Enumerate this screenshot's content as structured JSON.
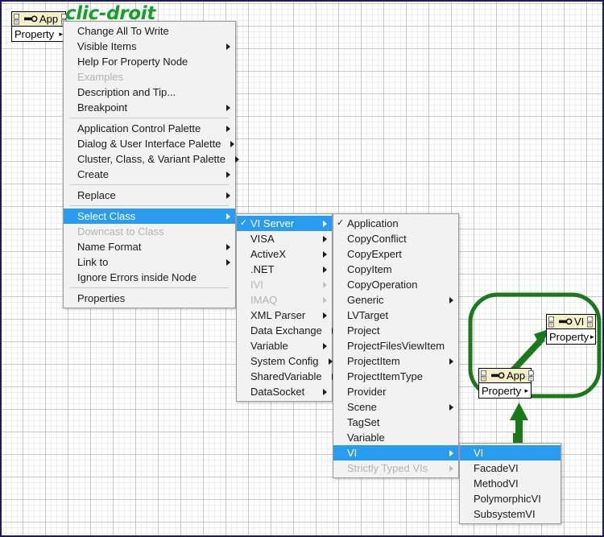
{
  "canvas": {
    "title": "clic-droit",
    "title_color": "#14a02a",
    "accent_highlight": "#2a9cf0",
    "annotation_color": "#1a7a1a",
    "border_color": "#1b1b5e"
  },
  "nodes": {
    "app_node_topleft": {
      "ref_label": "App",
      "body_label": "Property",
      "arrow": "▸"
    },
    "app_node_circle": {
      "ref_label": "App",
      "body_label": "Property",
      "arrow": "▸"
    },
    "vi_node_circle": {
      "ref_label": "VI",
      "body_label": "Property",
      "arrow": "▸"
    }
  },
  "menus": {
    "context_menu": {
      "name": "property-node-context-menu",
      "items": [
        {
          "label": "Change All To Write",
          "submenu": false,
          "checked": false,
          "disabled": false,
          "selected": false
        },
        {
          "label": "Visible Items",
          "submenu": true,
          "checked": false,
          "disabled": false,
          "selected": false
        },
        {
          "label": "Help For Property Node",
          "submenu": false,
          "checked": false,
          "disabled": false,
          "selected": false
        },
        {
          "label": "Examples",
          "submenu": false,
          "checked": false,
          "disabled": true,
          "selected": false
        },
        {
          "label": "Description and Tip...",
          "submenu": false,
          "checked": false,
          "disabled": false,
          "selected": false
        },
        {
          "label": "Breakpoint",
          "submenu": true,
          "checked": false,
          "disabled": false,
          "selected": false
        },
        {
          "separator": true
        },
        {
          "label": "Application Control Palette",
          "submenu": true,
          "checked": false,
          "disabled": false,
          "selected": false
        },
        {
          "label": "Dialog & User Interface Palette",
          "submenu": true,
          "checked": false,
          "disabled": false,
          "selected": false
        },
        {
          "label": "Cluster, Class, & Variant Palette",
          "submenu": true,
          "checked": false,
          "disabled": false,
          "selected": false
        },
        {
          "label": "Create",
          "submenu": true,
          "checked": false,
          "disabled": false,
          "selected": false
        },
        {
          "separator": true
        },
        {
          "label": "Replace",
          "submenu": true,
          "checked": false,
          "disabled": false,
          "selected": false
        },
        {
          "separator": true
        },
        {
          "label": "Select Class",
          "submenu": true,
          "checked": false,
          "disabled": false,
          "selected": true
        },
        {
          "label": "Downcast to Class",
          "submenu": false,
          "checked": false,
          "disabled": true,
          "selected": false
        },
        {
          "label": "Name Format",
          "submenu": true,
          "checked": false,
          "disabled": false,
          "selected": false
        },
        {
          "label": "Link to",
          "submenu": true,
          "checked": false,
          "disabled": false,
          "selected": false
        },
        {
          "label": "Ignore Errors inside Node",
          "submenu": false,
          "checked": false,
          "disabled": false,
          "selected": false
        },
        {
          "separator": true
        },
        {
          "label": "Properties",
          "submenu": false,
          "checked": false,
          "disabled": false,
          "selected": false
        }
      ]
    },
    "select_class_menu": {
      "name": "select-class-submenu",
      "items": [
        {
          "label": "VI Server",
          "submenu": true,
          "checked": true,
          "disabled": false,
          "selected": true
        },
        {
          "label": "VISA",
          "submenu": true,
          "checked": false,
          "disabled": false,
          "selected": false
        },
        {
          "label": "ActiveX",
          "submenu": true,
          "checked": false,
          "disabled": false,
          "selected": false
        },
        {
          "label": ".NET",
          "submenu": true,
          "checked": false,
          "disabled": false,
          "selected": false
        },
        {
          "label": "IVI",
          "submenu": true,
          "checked": false,
          "disabled": true,
          "selected": false
        },
        {
          "label": "IMAQ",
          "submenu": true,
          "checked": false,
          "disabled": true,
          "selected": false
        },
        {
          "label": "XML Parser",
          "submenu": true,
          "checked": false,
          "disabled": false,
          "selected": false
        },
        {
          "label": "Data Exchange",
          "submenu": true,
          "checked": false,
          "disabled": false,
          "selected": false
        },
        {
          "label": "Variable",
          "submenu": true,
          "checked": false,
          "disabled": false,
          "selected": false
        },
        {
          "label": "System Config",
          "submenu": true,
          "checked": false,
          "disabled": false,
          "selected": false
        },
        {
          "label": "SharedVariable",
          "submenu": true,
          "checked": false,
          "disabled": false,
          "selected": false
        },
        {
          "label": "DataSocket",
          "submenu": true,
          "checked": false,
          "disabled": false,
          "selected": false
        }
      ]
    },
    "vi_server_menu": {
      "name": "vi-server-submenu",
      "items": [
        {
          "label": "Application",
          "submenu": false,
          "checked": true,
          "disabled": false,
          "selected": false
        },
        {
          "label": "CopyConflict",
          "submenu": false,
          "checked": false,
          "disabled": false,
          "selected": false
        },
        {
          "label": "CopyExpert",
          "submenu": false,
          "checked": false,
          "disabled": false,
          "selected": false
        },
        {
          "label": "CopyItem",
          "submenu": false,
          "checked": false,
          "disabled": false,
          "selected": false
        },
        {
          "label": "CopyOperation",
          "submenu": false,
          "checked": false,
          "disabled": false,
          "selected": false
        },
        {
          "label": "Generic",
          "submenu": true,
          "checked": false,
          "disabled": false,
          "selected": false
        },
        {
          "label": "LVTarget",
          "submenu": false,
          "checked": false,
          "disabled": false,
          "selected": false
        },
        {
          "label": "Project",
          "submenu": false,
          "checked": false,
          "disabled": false,
          "selected": false
        },
        {
          "label": "ProjectFilesViewItem",
          "submenu": false,
          "checked": false,
          "disabled": false,
          "selected": false
        },
        {
          "label": "ProjectItem",
          "submenu": true,
          "checked": false,
          "disabled": false,
          "selected": false
        },
        {
          "label": "ProjectItemType",
          "submenu": false,
          "checked": false,
          "disabled": false,
          "selected": false
        },
        {
          "label": "Provider",
          "submenu": false,
          "checked": false,
          "disabled": false,
          "selected": false
        },
        {
          "label": "Scene",
          "submenu": true,
          "checked": false,
          "disabled": false,
          "selected": false
        },
        {
          "label": "TagSet",
          "submenu": false,
          "checked": false,
          "disabled": false,
          "selected": false
        },
        {
          "label": "Variable",
          "submenu": false,
          "checked": false,
          "disabled": false,
          "selected": false
        },
        {
          "label": "VI",
          "submenu": true,
          "checked": false,
          "disabled": false,
          "selected": true
        },
        {
          "label": "Strictly Typed VIs",
          "submenu": true,
          "checked": false,
          "disabled": true,
          "selected": false
        }
      ]
    },
    "vi_menu": {
      "name": "vi-submenu",
      "items": [
        {
          "label": "VI",
          "submenu": false,
          "checked": false,
          "disabled": false,
          "selected": true
        },
        {
          "label": "FacadeVI",
          "submenu": false,
          "checked": false,
          "disabled": false,
          "selected": false
        },
        {
          "label": "MethodVI",
          "submenu": false,
          "checked": false,
          "disabled": false,
          "selected": false
        },
        {
          "label": "PolymorphicVI",
          "submenu": false,
          "checked": false,
          "disabled": false,
          "selected": false
        },
        {
          "label": "SubsystemVI",
          "submenu": false,
          "checked": false,
          "disabled": false,
          "selected": false
        }
      ]
    }
  }
}
